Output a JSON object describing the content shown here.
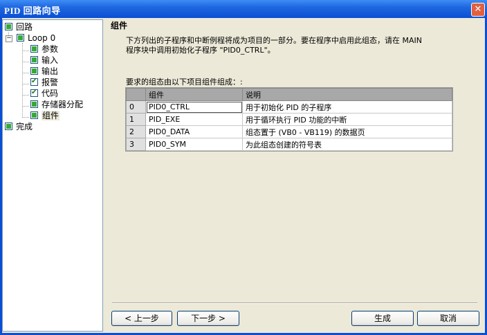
{
  "window": {
    "title": "PID 回路向导",
    "close_glyph": "✕"
  },
  "tree": {
    "root": {
      "label": "回路"
    },
    "loop": {
      "label": "Loop 0",
      "expander": "−"
    },
    "children": [
      {
        "label": "参数",
        "checked": false
      },
      {
        "label": "输入",
        "checked": false
      },
      {
        "label": "输出",
        "checked": false
      },
      {
        "label": "报警",
        "checked": true
      },
      {
        "label": "代码",
        "checked": true
      },
      {
        "label": "存储器分配",
        "checked": false
      },
      {
        "label": "组件",
        "checked": false,
        "selected": true
      }
    ],
    "finish": {
      "label": "完成"
    }
  },
  "main": {
    "heading": "组件",
    "desc_line1": "下方列出的子程序和中断例程将成为项目的一部分。要在程序中启用此组态，请在 MAIN",
    "desc_line2": "程序块中调用初始化子程序 \"PID0_CTRL\"。",
    "req_label": "要求的组态由以下项目组件组成：:"
  },
  "table": {
    "headers": {
      "component": "组件",
      "description": "说明"
    },
    "rows": [
      {
        "index": "0",
        "component": "PID0_CTRL",
        "description": "用于初始化 PID 的子程序"
      },
      {
        "index": "1",
        "component": "PID_EXE",
        "description": "用于循环执行 PID 功能的中断"
      },
      {
        "index": "2",
        "component": "PID0_DATA",
        "description": "组态置于 (VB0 - VB119) 的数据页"
      },
      {
        "index": "3",
        "component": "PID0_SYM",
        "description": "为此组态创建的符号表"
      }
    ]
  },
  "buttons": {
    "prev": "< 上一步",
    "next": "下一步 >",
    "generate": "生成",
    "cancel": "取消"
  }
}
